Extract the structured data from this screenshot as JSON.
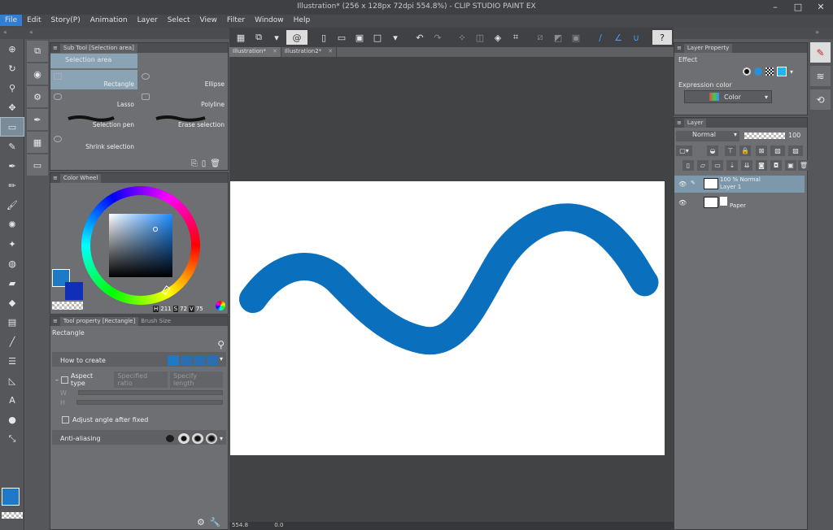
{
  "window": {
    "title": "Illustration* (256 x 128px 72dpi 554.8%) - CLIP STUDIO PAINT EX"
  },
  "menu": [
    "File",
    "Edit",
    "Story(P)",
    "Animation",
    "Layer",
    "Select",
    "View",
    "Filter",
    "Window",
    "Help"
  ],
  "sub_tool_panel": {
    "tab": "Sub Tool [Selection area]",
    "group": "Selection area",
    "items": [
      "Rectangle",
      "Ellipse",
      "Lasso",
      "Polyline",
      "Selection pen",
      "Erase selection",
      "Shrink selection"
    ]
  },
  "color_wheel": {
    "tab": "Color Wheel",
    "h_label": "H",
    "h_value": "211",
    "s_label": "S",
    "s_value": "72",
    "v_label": "V",
    "v_value": "75",
    "fg_color": "#1e7ac6",
    "bg_color": "#0f2fb8"
  },
  "tool_property": {
    "tab": "Tool property [Rectangle]",
    "tab2": "Brush Size",
    "title": "Rectangle",
    "how_to_create": "How to create",
    "aspect_type": "Aspect type",
    "specified_ratio": "Specified ratio",
    "specify_length": "Specify length",
    "w_label": "W",
    "h_label": "H",
    "adjust_angle": "Adjust angle after fixed",
    "anti_aliasing": "Anti-aliasing"
  },
  "doc_tabs": [
    "Illustration*",
    "Illustration2*"
  ],
  "status": {
    "zoom": "554.8",
    "coord": "0.0"
  },
  "layer_property": {
    "tab": "Layer Property",
    "effect": "Effect",
    "expression_color": "Expression color",
    "color_mode": "Color"
  },
  "layer_panel": {
    "tab": "Layer",
    "blend": "Normal",
    "opacity": "100",
    "layers": [
      {
        "line1": "100 % Normal",
        "line2": "Layer 1"
      },
      {
        "line1": "",
        "line2": "Paper"
      }
    ]
  },
  "canvas": {
    "stroke_color": "#0a6fbd"
  }
}
